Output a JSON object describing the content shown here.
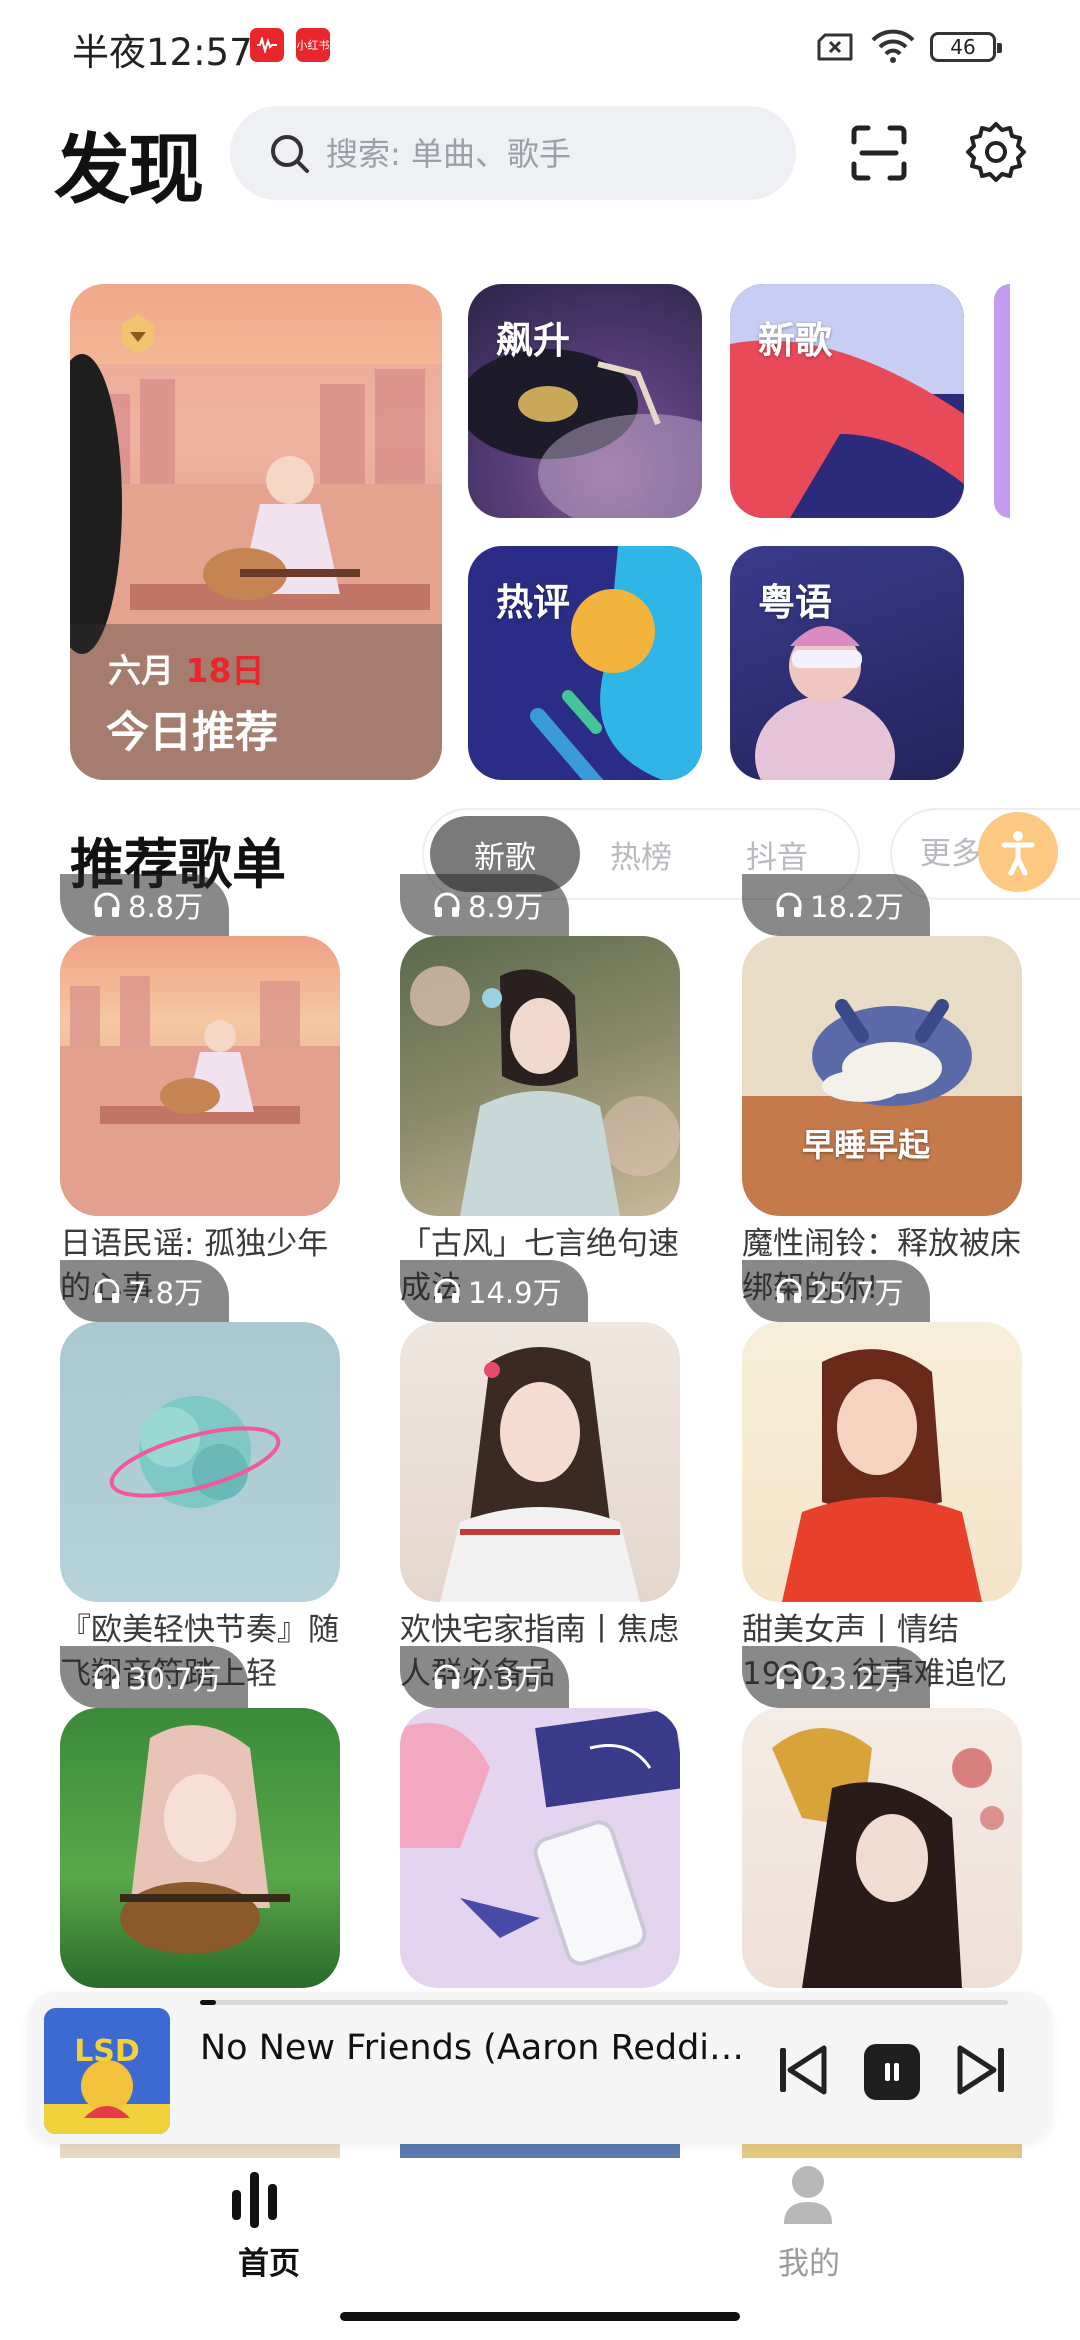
{
  "status_bar": {
    "time": "半夜12:57",
    "app_icon_2": "小红书",
    "battery": "46"
  },
  "header": {
    "title": "发现",
    "search_placeholder": "搜索: 单曲、歌手",
    "icons": [
      "search-icon",
      "scan-icon",
      "settings-icon"
    ]
  },
  "feature": {
    "daily": {
      "month": "六月",
      "day": "18日",
      "label": "今日推荐"
    },
    "tiles": [
      {
        "label": "飙升"
      },
      {
        "label": "新歌"
      },
      {
        "label": "热评"
      },
      {
        "label": "粤语"
      }
    ]
  },
  "recommend": {
    "title": "推荐歌单",
    "tabs": [
      "新歌",
      "热榜",
      "抖音"
    ],
    "active_tab": "新歌",
    "more": "更多",
    "playlists": [
      {
        "plays": "8.8万",
        "title": "日语民谣: 孤独少年的心事"
      },
      {
        "plays": "8.9万",
        "title": "「古风」七言绝句速成法"
      },
      {
        "plays": "18.2万",
        "title": "魔性闹铃：释放被床绑架的你!",
        "cover_text": "早睡早起"
      },
      {
        "plays": "7.8万",
        "title": "『欧美轻快节奏』随飞翔音符踏上轻"
      },
      {
        "plays": "14.9万",
        "title": "欢快宅家指南丨焦虑人群必备品"
      },
      {
        "plays": "25.7万",
        "title": "甜美女声丨情结1990，往事难追忆"
      },
      {
        "plays": "30.7万",
        "title": ""
      },
      {
        "plays": "7.3万",
        "title": ""
      },
      {
        "plays": "23.2万",
        "title": ""
      }
    ]
  },
  "player": {
    "song": "No New Friends (Aaron Redding…",
    "album_text": "LSD",
    "progress": 0.02
  },
  "nav": {
    "home": "首页",
    "mine": "我的"
  },
  "colors": {
    "accent": "#e8262b",
    "tab_active": "#7a7a7a",
    "access_button": "#fcc983"
  }
}
